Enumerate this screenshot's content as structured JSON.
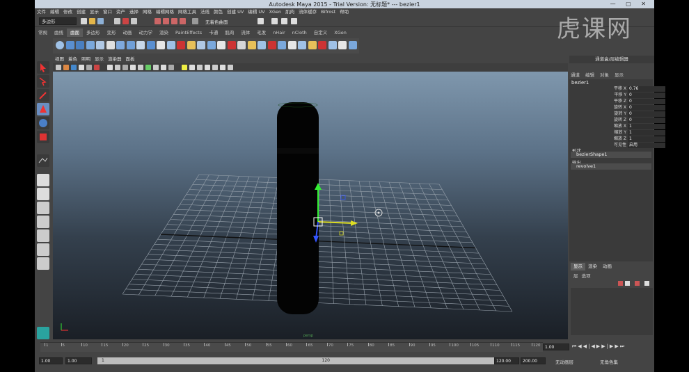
{
  "title_bar": {
    "title": "Autodesk Maya 2015 - Trial Version: 无标题*   ---   bezier1"
  },
  "menubar": [
    "文件",
    "编辑",
    "修改",
    "创建",
    "显示",
    "窗口",
    "资产",
    "选择",
    "网格",
    "编辑网格",
    "网格工具",
    "法线",
    "颜色",
    "创建 UV",
    "编辑 UV",
    "XGen",
    "肌肉",
    "流体缓存",
    "Bifrost",
    "帮助"
  ],
  "status_line": {
    "mode_dropdown": "多边形",
    "search_field": "无着色曲面"
  },
  "shelf_tabs": {
    "items": [
      "常规",
      "曲线",
      "曲面",
      "多边形",
      "变形",
      "动画",
      "动力学",
      "渲染",
      "PaintEffects",
      "卡通",
      "肌肉",
      "流体",
      "毛发",
      "nHair",
      "nCloth",
      "自定义",
      "XGen"
    ],
    "active": "曲面"
  },
  "viewport": {
    "menu": [
      "视图",
      "着色",
      "照明",
      "显示",
      "渲染器",
      "面板"
    ],
    "bottom_label": "persp"
  },
  "channel_box": {
    "header": "通道盒/层编辑器",
    "menu": [
      "通道",
      "编辑",
      "对象",
      "显示"
    ],
    "object": "bezier1",
    "attributes": [
      {
        "label": "平移 X",
        "value": "0.76"
      },
      {
        "label": "平移 Y",
        "value": "0"
      },
      {
        "label": "平移 Z",
        "value": "0"
      },
      {
        "label": "旋转 X",
        "value": "0"
      },
      {
        "label": "旋转 Y",
        "value": "0"
      },
      {
        "label": "旋转 Z",
        "value": "0"
      },
      {
        "label": "缩放 X",
        "value": "1"
      },
      {
        "label": "缩放 Y",
        "value": "1"
      },
      {
        "label": "缩放 Z",
        "value": "1"
      },
      {
        "label": "可见性",
        "value": "启用"
      }
    ],
    "shapes_label": "形状",
    "shape_item": "bezierShape1",
    "outputs_label": "输出",
    "output_item": "revolve1"
  },
  "layer_editor": {
    "tabs": [
      "显示",
      "渲染",
      "动画"
    ],
    "active": "显示",
    "menu": [
      "层",
      "选项"
    ]
  },
  "time_slider": {
    "ticks": [
      "1",
      "5",
      "10",
      "15",
      "20",
      "25",
      "30",
      "35",
      "40",
      "45",
      "50",
      "55",
      "60",
      "65",
      "70",
      "75",
      "80",
      "85",
      "90",
      "95",
      "100",
      "105",
      "110",
      "115",
      "120"
    ],
    "current": "1.00"
  },
  "range_slider": {
    "start": "1.00",
    "start_inner": "1.00",
    "range_start": "1",
    "range_end": "120",
    "end_inner": "120.00",
    "end": "200.00",
    "anim_layer": "无动画层",
    "char_set": "无角色集"
  },
  "watermark": {
    "text": "虎课网"
  },
  "colors": {
    "ui_bg": "#444444",
    "viewport_top": "#7f97ad",
    "viewport_bottom": "#1a1f26",
    "grid": "#9aa4ae",
    "axis_x": "#ff3333",
    "axis_y": "#33ff33",
    "axis_z": "#3355ff"
  }
}
